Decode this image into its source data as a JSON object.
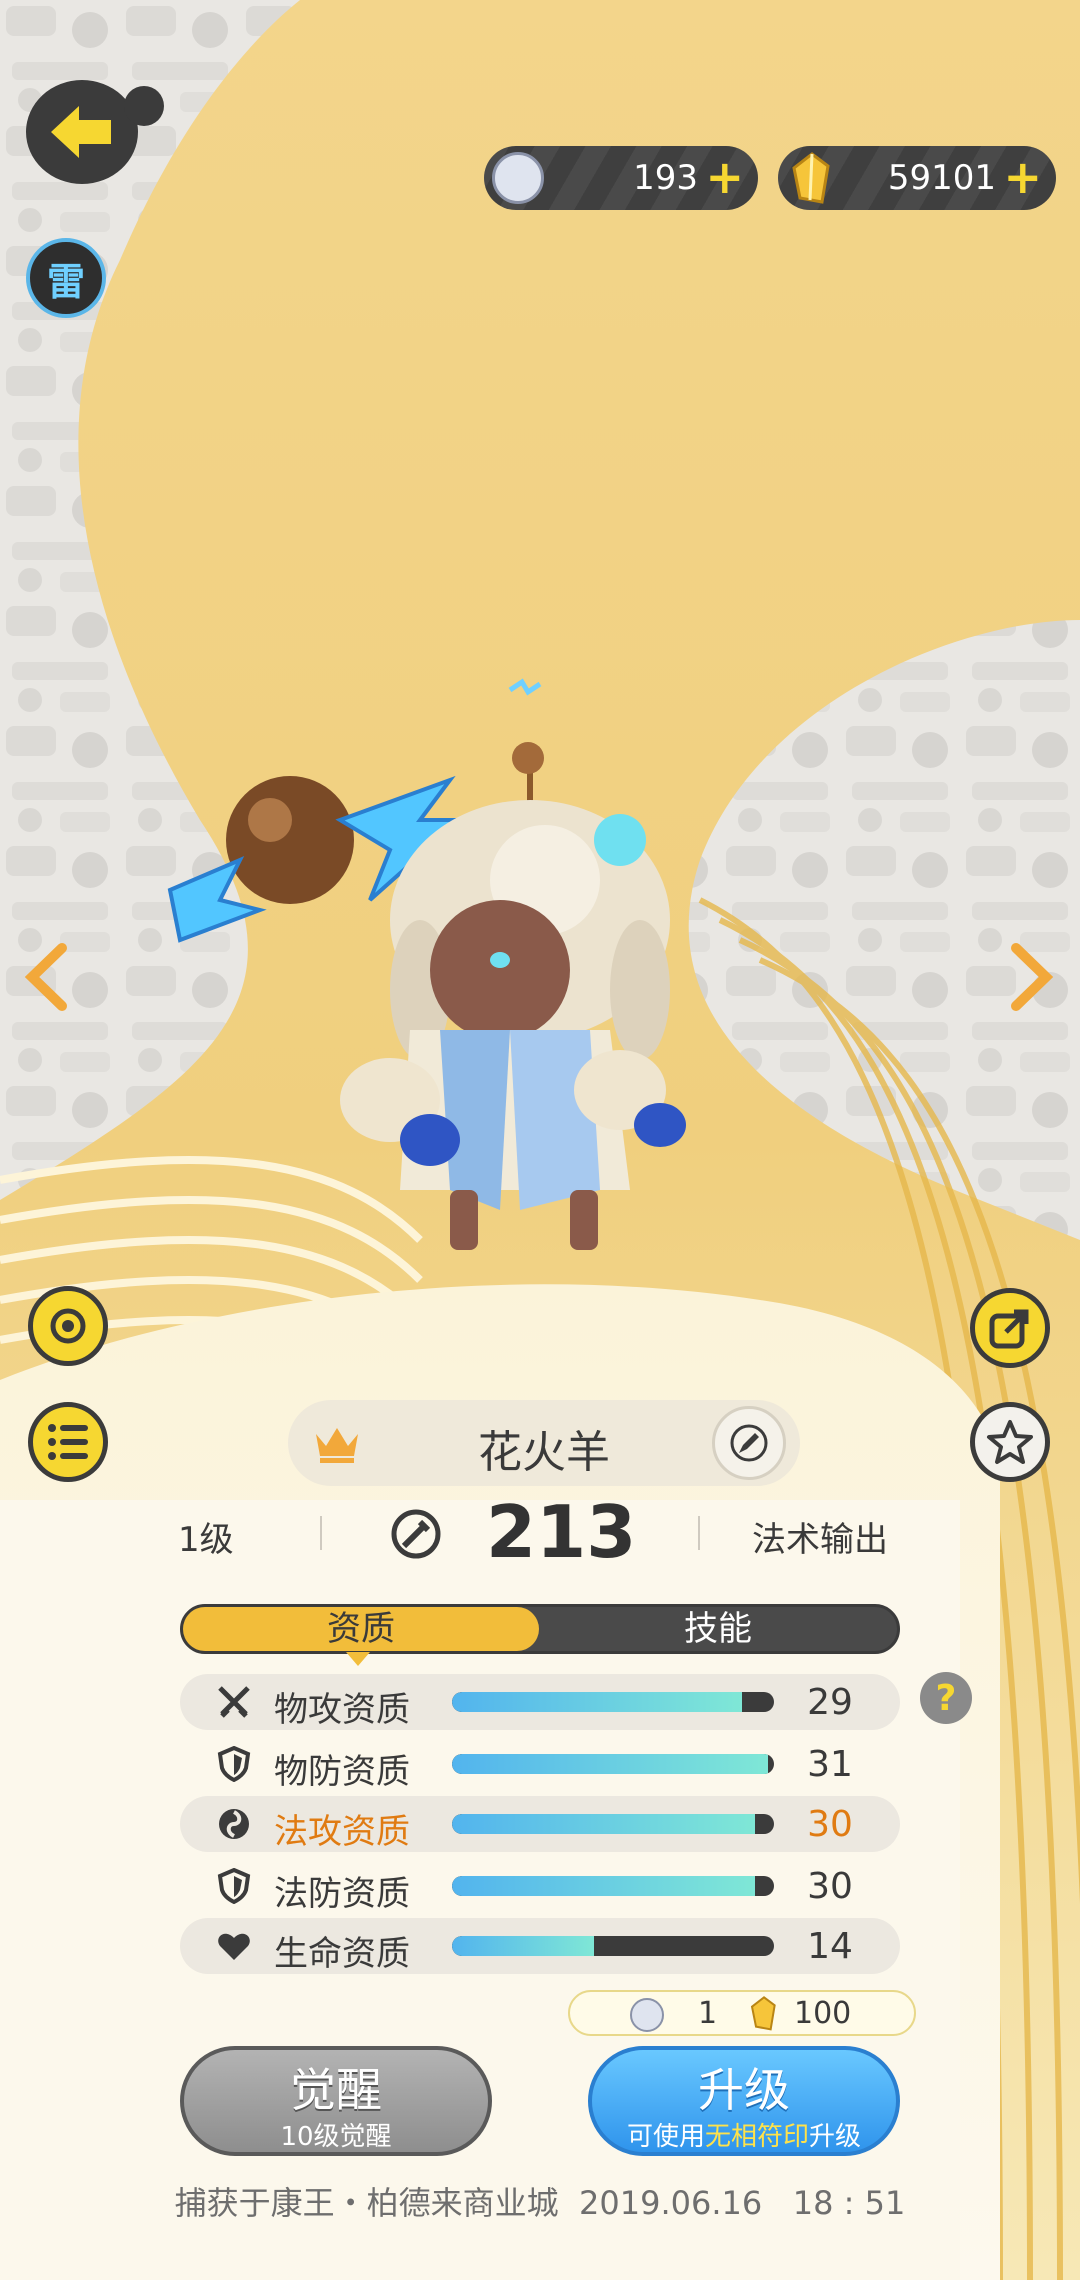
{
  "currencies": {
    "pet_food": {
      "value": "193",
      "icon": "pet-face-icon"
    },
    "crystal": {
      "value": "59101",
      "icon": "crystal-icon"
    }
  },
  "element_badge": "雷",
  "pet": {
    "name": "花火羊",
    "level": "1级",
    "power": "213",
    "role": "法术输出"
  },
  "tabs": {
    "aptitude": "资质",
    "skills": "技能",
    "active": "aptitude"
  },
  "stats": [
    {
      "label": "物攻资质",
      "value": "29",
      "fill": 0.9,
      "icon": "swords-icon",
      "highlight": false
    },
    {
      "label": "物防资质",
      "value": "31",
      "fill": 0.98,
      "icon": "shield-icon",
      "highlight": false
    },
    {
      "label": "法攻资质",
      "value": "30",
      "fill": 0.94,
      "icon": "magic-swirl-icon",
      "highlight": true
    },
    {
      "label": "法防资质",
      "value": "30",
      "fill": 0.94,
      "icon": "shield-icon",
      "highlight": false
    },
    {
      "label": "生命资质",
      "value": "14",
      "fill": 0.44,
      "icon": "heart-icon",
      "highlight": false
    }
  ],
  "cost": {
    "pet_food": "1",
    "crystal": "100"
  },
  "awaken_button": {
    "title": "觉醒",
    "subtitle": "10级觉醒"
  },
  "upgrade_button": {
    "title": "升级",
    "sub_prefix": "可使用",
    "sub_highlight": "无相符印",
    "sub_suffix": "升级"
  },
  "capture_info": "捕获于康王・柏德来商业城  2019.06.16   18 : 51",
  "colors": {
    "accent_yellow": "#f6d731",
    "gold": "#f2bd3a",
    "dark": "#3b3b3b",
    "blue": "#3fa8f4",
    "highlight": "#e07b12"
  }
}
